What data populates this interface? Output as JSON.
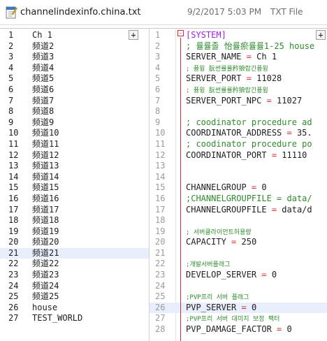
{
  "file": {
    "name": "channelindexinfo.china.txt",
    "date": "9/2/2017 5:03 PM",
    "type": "TXT File",
    "icon": "notepad-file-icon"
  },
  "left_pane": {
    "add_label": "+",
    "highlight_line": 21,
    "lines": [
      {
        "n": "1",
        "t": "Ch 1"
      },
      {
        "n": "2",
        "t": "频道2"
      },
      {
        "n": "3",
        "t": "频道3"
      },
      {
        "n": "4",
        "t": "频道4"
      },
      {
        "n": "5",
        "t": "频道5"
      },
      {
        "n": "6",
        "t": "频道6"
      },
      {
        "n": "7",
        "t": "频道7"
      },
      {
        "n": "8",
        "t": "频道8"
      },
      {
        "n": "9",
        "t": "频道9"
      },
      {
        "n": "10",
        "t": "频道10"
      },
      {
        "n": "11",
        "t": "频道11"
      },
      {
        "n": "12",
        "t": "频道12"
      },
      {
        "n": "13",
        "t": "频道13"
      },
      {
        "n": "14",
        "t": "频道14"
      },
      {
        "n": "15",
        "t": "频道15"
      },
      {
        "n": "16",
        "t": "频道16"
      },
      {
        "n": "17",
        "t": "频道17"
      },
      {
        "n": "18",
        "t": "频道18"
      },
      {
        "n": "19",
        "t": "频道19"
      },
      {
        "n": "20",
        "t": "频道20"
      },
      {
        "n": "21",
        "t": "频道21"
      },
      {
        "n": "22",
        "t": "频道22"
      },
      {
        "n": "23",
        "t": "频道23"
      },
      {
        "n": "24",
        "t": "频道24"
      },
      {
        "n": "25",
        "t": "频道25"
      },
      {
        "n": "26",
        "t": "house"
      },
      {
        "n": "27",
        "t": "TEST_WORLD"
      }
    ]
  },
  "right_pane": {
    "add_label": "+",
    "fold_label": "-",
    "highlight_line": 26,
    "lines": [
      {
        "n": "1",
        "segs": [
          {
            "c": "c-section",
            "t": "[SYSTEM]"
          }
        ]
      },
      {
        "n": "2",
        "segs": [
          {
            "c": "c-comment",
            "t": "; 률률졸 怡률瘀률률1-25  house"
          }
        ]
      },
      {
        "n": "3",
        "segs": [
          {
            "c": "c-key",
            "t": "SERVER_NAME "
          },
          {
            "c": "c-op",
            "t": "="
          },
          {
            "c": "c-val",
            "t": " Ch 1"
          }
        ]
      },
      {
        "n": "4",
        "segs": [
          {
            "c": "c-comment c-small",
            "t": "; 퓽윙 朊썬률률矜狼랍긴퓽윙"
          }
        ]
      },
      {
        "n": "5",
        "segs": [
          {
            "c": "c-key",
            "t": "SERVER_PORT "
          },
          {
            "c": "c-op",
            "t": "="
          },
          {
            "c": "c-val",
            "t": " 11028"
          }
        ]
      },
      {
        "n": "6",
        "segs": [
          {
            "c": "c-comment c-small",
            "t": "; 퓽윙 朊썬률률矜狼랍긴퓽윙"
          }
        ]
      },
      {
        "n": "7",
        "segs": [
          {
            "c": "c-key",
            "t": "SERVER_PORT_NPC "
          },
          {
            "c": "c-op",
            "t": "="
          },
          {
            "c": "c-val",
            "t": " 11027"
          }
        ]
      },
      {
        "n": "8",
        "segs": []
      },
      {
        "n": "9",
        "segs": [
          {
            "c": "c-comment",
            "t": "; coodinator procedure ad"
          }
        ]
      },
      {
        "n": "10",
        "segs": [
          {
            "c": "c-key",
            "t": "COORDINATOR_ADDRESS "
          },
          {
            "c": "c-op",
            "t": "="
          },
          {
            "c": "c-val",
            "t": " 35."
          }
        ]
      },
      {
        "n": "11",
        "segs": [
          {
            "c": "c-comment",
            "t": "; coodinator procedure po"
          }
        ]
      },
      {
        "n": "12",
        "segs": [
          {
            "c": "c-key",
            "t": "COORDINATOR_PORT "
          },
          {
            "c": "c-op",
            "t": "="
          },
          {
            "c": "c-val",
            "t": " 11110"
          }
        ]
      },
      {
        "n": "13",
        "segs": []
      },
      {
        "n": "14",
        "segs": []
      },
      {
        "n": "15",
        "segs": [
          {
            "c": "c-key",
            "t": "CHANNELGROUP "
          },
          {
            "c": "c-op",
            "t": "="
          },
          {
            "c": "c-val",
            "t": " 0"
          }
        ]
      },
      {
        "n": "16",
        "segs": [
          {
            "c": "c-comment",
            "t": ";CHANNELGROUPFILE = data/"
          }
        ]
      },
      {
        "n": "17",
        "segs": [
          {
            "c": "c-key",
            "t": "CHANNELGROUPFILE "
          },
          {
            "c": "c-op",
            "t": "="
          },
          {
            "c": "c-val",
            "t": " data/d"
          }
        ]
      },
      {
        "n": "18",
        "segs": []
      },
      {
        "n": "19",
        "segs": [
          {
            "c": "c-comment c-small",
            "t": "; 서버클라이언트허용량"
          }
        ]
      },
      {
        "n": "20",
        "segs": [
          {
            "c": "c-key",
            "t": "CAPACITY "
          },
          {
            "c": "c-op",
            "t": "="
          },
          {
            "c": "c-val",
            "t": " 250"
          }
        ]
      },
      {
        "n": "21",
        "segs": []
      },
      {
        "n": "22",
        "segs": [
          {
            "c": "c-comment c-small",
            "t": ";개발서버플래그"
          }
        ]
      },
      {
        "n": "23",
        "segs": [
          {
            "c": "c-key",
            "t": "DEVELOP_SERVER "
          },
          {
            "c": "c-op",
            "t": "="
          },
          {
            "c": "c-val",
            "t": " 0"
          }
        ]
      },
      {
        "n": "24",
        "segs": []
      },
      {
        "n": "25",
        "segs": [
          {
            "c": "c-comment c-small",
            "t": ";PVP프리 서버 플래그"
          }
        ]
      },
      {
        "n": "26",
        "segs": [
          {
            "c": "c-key",
            "t": "PVP_SERVER "
          },
          {
            "c": "c-op",
            "t": "="
          },
          {
            "c": "c-val",
            "t": " 0"
          }
        ]
      },
      {
        "n": "27",
        "segs": [
          {
            "c": "c-comment c-small",
            "t": ";PVP프리 서버 대미지 보정 팩터"
          }
        ]
      },
      {
        "n": "28",
        "segs": [
          {
            "c": "c-key",
            "t": "PVP_DAMAGE_FACTOR "
          },
          {
            "c": "c-op",
            "t": "="
          },
          {
            "c": "c-val",
            "t": " 0"
          }
        ]
      }
    ]
  }
}
